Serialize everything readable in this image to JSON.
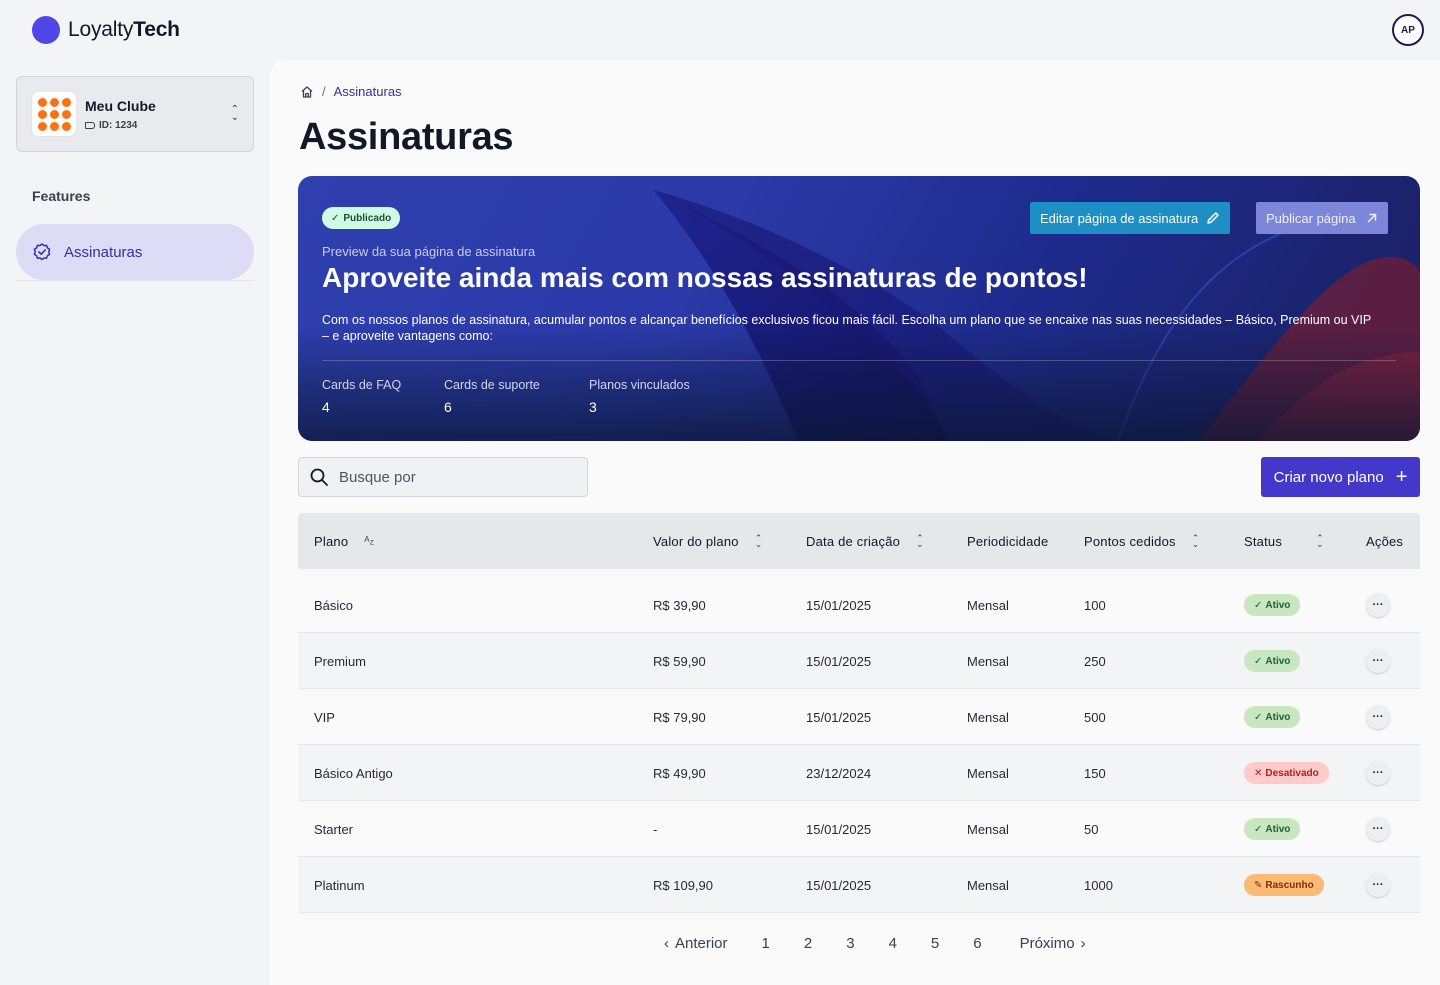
{
  "app": {
    "logo_light": "Loyalty",
    "logo_bold": "Tech",
    "avatar_initials": "AP",
    "accent": "#4f46e5"
  },
  "sidebar": {
    "club": {
      "name": "Meu Clube",
      "id_label": "ID: 1234"
    },
    "section_label": "Features",
    "items": [
      {
        "label": "Assinaturas",
        "icon": "badge-check-icon",
        "active": true
      }
    ]
  },
  "breadcrumb": {
    "home_icon": "home-icon",
    "current": "Assinaturas"
  },
  "page": {
    "title": "Assinaturas"
  },
  "banner": {
    "status_badge": "Publicado",
    "kicker": "Preview da sua página de assinatura",
    "title": "Aproveite ainda mais com nossas assinaturas de pontos!",
    "description": "Com os nossos planos de assinatura, acumular pontos e alcançar benefícios exclusivos ficou mais fácil. Escolha um plano que se encaixe nas suas necessidades – Básico, Premium ou VIP – e aproveite vantagens como:",
    "stats": [
      {
        "label": "Cards de FAQ",
        "value": "4"
      },
      {
        "label": "Cards de suporte",
        "value": "6"
      },
      {
        "label": "Planos vinculados",
        "value": "3"
      }
    ],
    "edit_button": "Editar página de assinatura",
    "publish_button": "Publicar  página"
  },
  "search": {
    "placeholder": "Busque por"
  },
  "create_button": "Criar novo plano",
  "table": {
    "columns": [
      "Plano",
      "Valor do plano",
      "Data de criação",
      "Periodicidade",
      "Pontos cedidos",
      "Status",
      "Ações"
    ],
    "rows": [
      {
        "plano": "Básico",
        "valor": "R$ 39,90",
        "data": "15/01/2025",
        "periodicidade": "Mensal",
        "pontos": "100",
        "status": "Ativo"
      },
      {
        "plano": "Premium",
        "valor": "R$ 59,90",
        "data": "15/01/2025",
        "periodicidade": "Mensal",
        "pontos": "250",
        "status": "Ativo"
      },
      {
        "plano": "VIP",
        "valor": "R$ 79,90",
        "data": "15/01/2025",
        "periodicidade": "Mensal",
        "pontos": "500",
        "status": "Ativo"
      },
      {
        "plano": "Básico Antigo",
        "valor": "R$ 49,90",
        "data": "23/12/2024",
        "periodicidade": "Mensal",
        "pontos": "150",
        "status": "Desativado"
      },
      {
        "plano": "Starter",
        "valor": "-",
        "data": "15/01/2025",
        "periodicidade": "Mensal",
        "pontos": "50",
        "status": "Ativo"
      },
      {
        "plano": "Platinum",
        "valor": "R$ 109,90",
        "data": "15/01/2025",
        "periodicidade": "Mensal",
        "pontos": "1000",
        "status": "Rascunho"
      }
    ],
    "actions_glyph": "···"
  },
  "pagination": {
    "prev": "Anterior",
    "next": "Próximo",
    "pages": [
      "1",
      "2",
      "3",
      "4",
      "5",
      "6"
    ]
  },
  "status_colors": {
    "Ativo": "#c8e6c0",
    "Desativado": "#fecaca",
    "Rascunho": "#fdba74"
  }
}
